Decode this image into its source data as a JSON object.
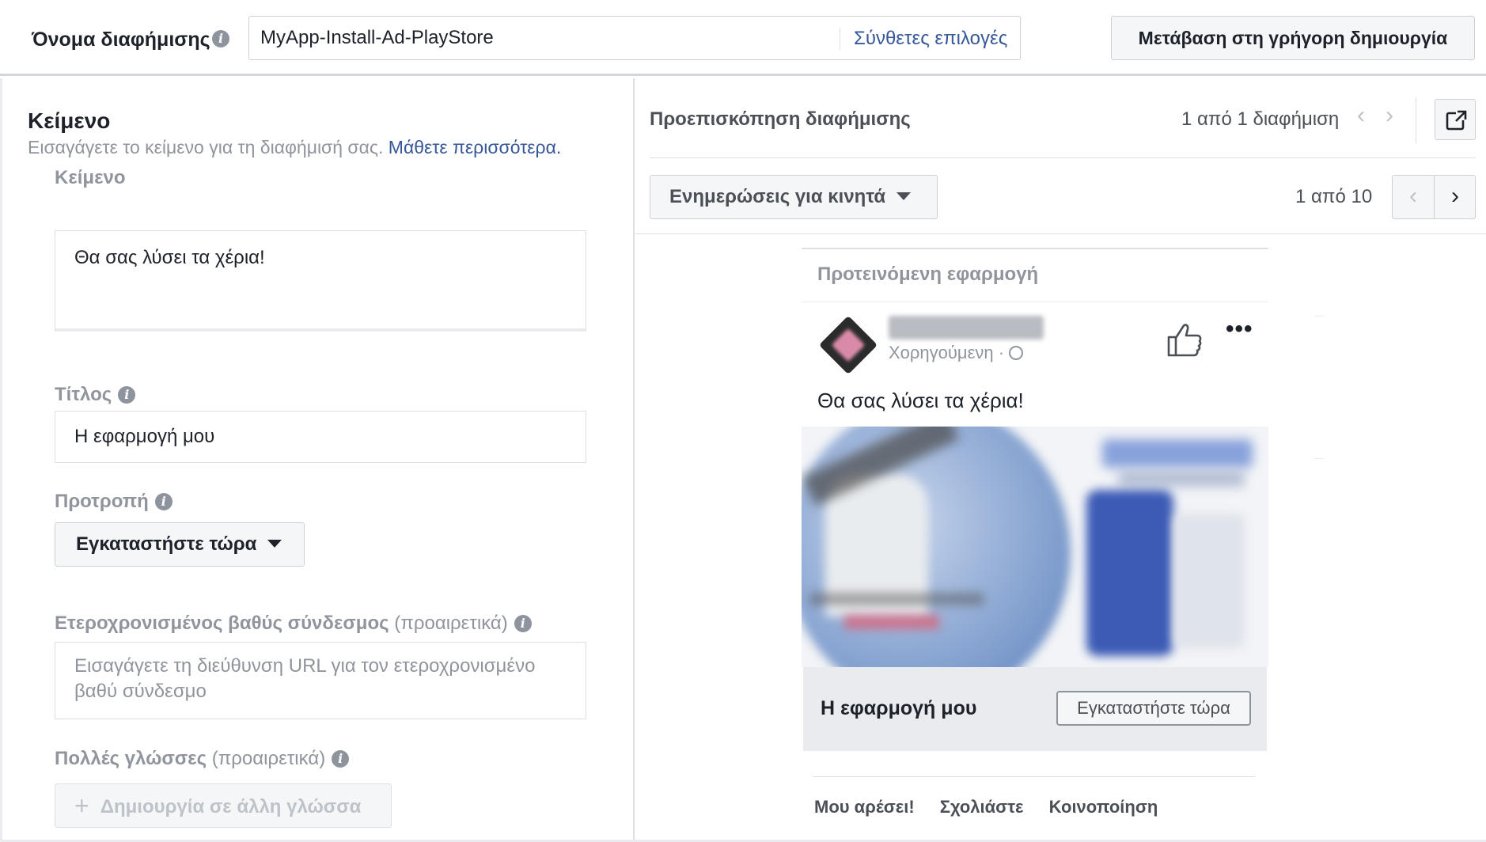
{
  "header": {
    "ad_name_label": "Όνομα διαφήμισης",
    "ad_name_value": "MyApp-Install-Ad-PlayStore",
    "advanced_options": "Σύνθετες επιλογές",
    "quick_create": "Μετάβαση στη γρήγορη δημιουργία"
  },
  "form": {
    "section_title": "Κείμενο",
    "section_subtitle": "Εισαγάγετε το κείμενο για τη διαφήμισή σας.",
    "learn_more": "Μάθετε περισσότερα.",
    "text_label": "Κείμενο",
    "text_value": "Θα σας λύσει τα χέρια!",
    "title_label": "Τίτλος",
    "title_value": "Η εφαρμογή μου",
    "cta_label": "Προτροπή",
    "cta_value": "Εγκαταστήστε τώρα",
    "deeplink_label": "Ετεροχρονισμένος βαθύς σύνδεσμος",
    "optional_suffix": "(προαιρετικά)",
    "deeplink_placeholder": "Εισαγάγετε τη διεύθυνση URL για τον ετεροχρονισμένο βαθύ σύνδεσμο",
    "languages_label": "Πολλές γλώσσες",
    "create_language": "Δημιουργία σε άλλη γλώσσα"
  },
  "preview": {
    "title": "Προεπισκόπηση διαφήμισης",
    "ad_count": "1 από 1 διαφήμιση",
    "placement": "Ενημερώσεις για κινητά",
    "placement_count": "1 από 10",
    "card": {
      "suggested_app": "Προτεινόμενη εφαρμογή",
      "sponsored": "Χορηγούμενη ·",
      "post_text": "Θα σας λύσει τα χέρια!",
      "app_title": "Η εφαρμογή μου",
      "cta_button": "Εγκαταστήστε τώρα",
      "like": "Μου αρέσει!",
      "comment": "Σχολιάστε",
      "share": "Κοινοποίηση"
    }
  },
  "colors": {
    "link": "#365899",
    "label_gray": "#90949c",
    "button_bg": "#f5f6f7",
    "border": "#ccd0d5"
  }
}
